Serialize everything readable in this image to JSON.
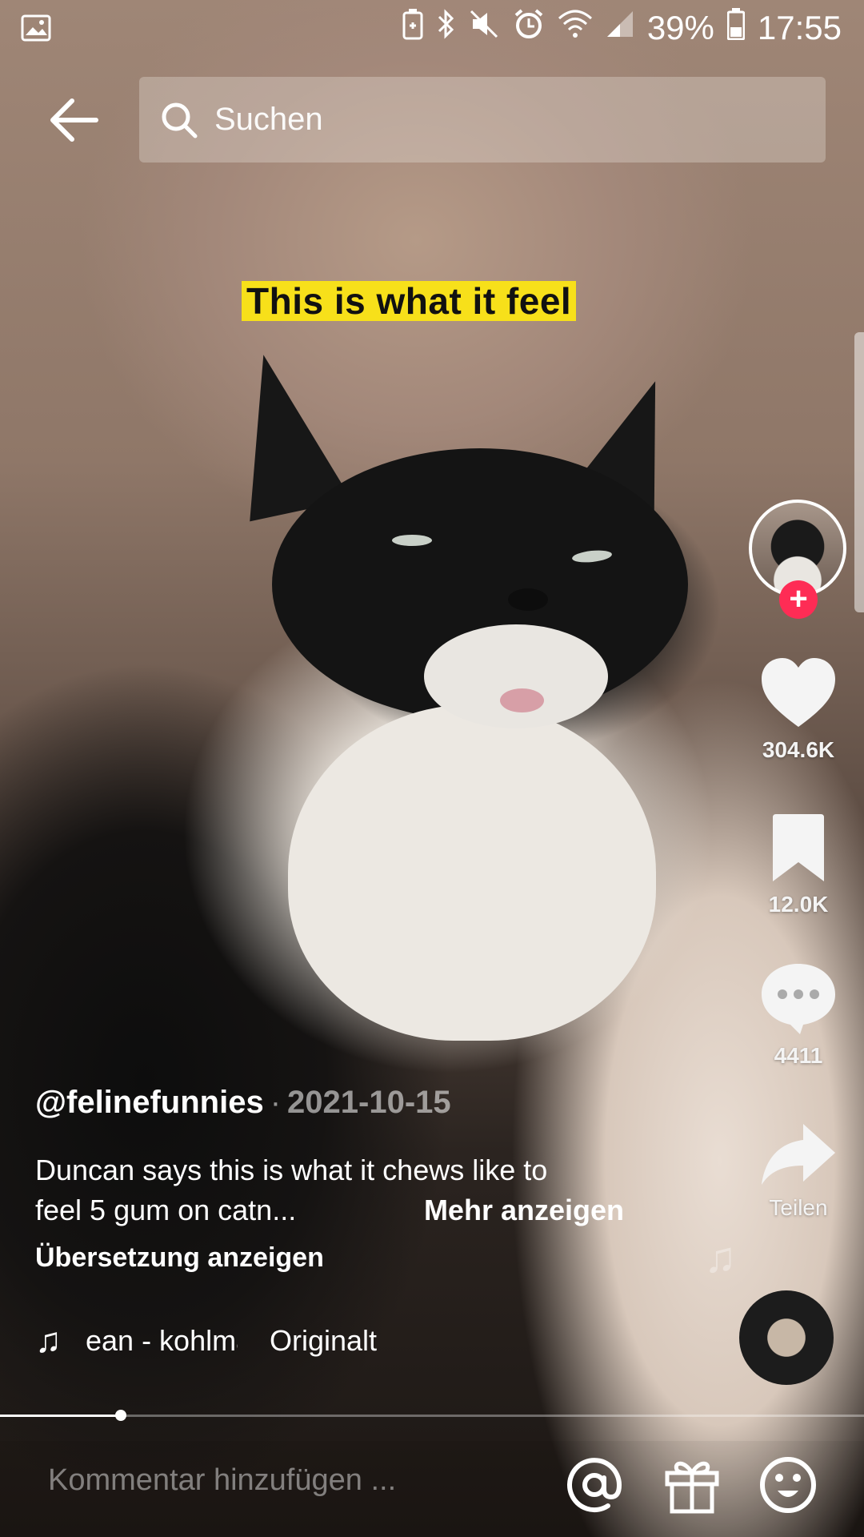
{
  "status_bar": {
    "battery_percent": "39%",
    "time": "17:55",
    "icons": [
      "image-notification-icon",
      "battery-saver-icon",
      "bluetooth-icon",
      "mute-vibrate-icon",
      "alarm-icon",
      "wifi-icon",
      "signal-icon",
      "battery-icon"
    ]
  },
  "header": {
    "back_icon": "arrow-left-icon",
    "search_placeholder": "Suchen"
  },
  "video": {
    "caption": "This is what it feel"
  },
  "actions": {
    "likes": "304.6K",
    "saves": "12.0K",
    "comments": "4411",
    "share_label": "Teilen",
    "follow_symbol": "+"
  },
  "post": {
    "username": "@felinefunnies",
    "separator": "·",
    "date": "2021-10-15",
    "description_line1": "Duncan says this is what it chews like to",
    "description_line2": "feel 5 gum on catn...",
    "more_label": "Mehr anzeigen",
    "translate_label": "Übersetzung anzeigen",
    "sound_artist": "ean - kohlmann",
    "sound_title": "Originalt"
  },
  "playback": {
    "progress_fraction": 0.14
  },
  "comment_bar": {
    "placeholder": "Kommentar hinzufügen ..."
  }
}
